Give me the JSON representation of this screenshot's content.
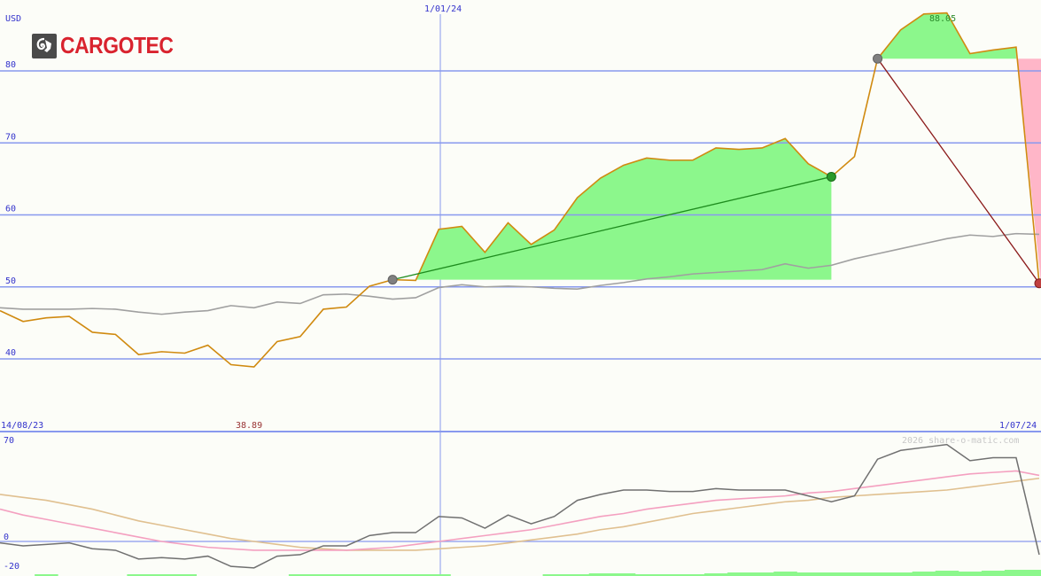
{
  "logo": {
    "name": "CARGOTEC",
    "icon": "ram-icon"
  },
  "colors": {
    "background": "#fcfdf8",
    "grid": "#8899ee",
    "price_line": "#d08a10",
    "moving_average": "#a0a0a0",
    "gain_fill": "#8cf78c",
    "loss_fill": "#ffb6c8",
    "up_trend": "#1e8c1e",
    "down_trend": "#8b1a1a",
    "osc_line": "#707070",
    "osc_pink": "#f4a0c0",
    "osc_tan": "#e0c090",
    "label_blue": "#3333cc",
    "label_red": "#993333"
  },
  "chart_data": [
    {
      "type": "line",
      "title": "",
      "ylabel": "USD",
      "ylim": [
        35,
        89
      ],
      "yticks": [
        40,
        50,
        60,
        70,
        80
      ],
      "x_start_label": "14/08/23",
      "x_mid_label": "1/01/24",
      "x_end_label": "1/07/24",
      "min_label": "38.89",
      "max_label": "88.05",
      "series": [
        {
          "key": "price",
          "values": [
            46.7,
            45.2,
            45.7,
            45.9,
            43.7,
            43.4,
            40.6,
            41.0,
            40.8,
            41.9,
            39.2,
            38.89,
            42.4,
            43.1,
            46.9,
            47.2,
            50.1,
            51.0,
            50.9,
            58.0,
            58.4,
            54.8,
            58.9,
            55.9,
            57.9,
            62.4,
            65.1,
            66.9,
            67.9,
            67.6,
            67.6,
            69.3,
            69.1,
            69.3,
            70.6,
            67.1,
            65.3,
            68.1,
            81.7,
            85.7,
            87.9,
            88.05,
            82.4,
            82.9,
            83.3,
            50.5
          ]
        },
        {
          "key": "moving_average",
          "values": [
            47.1,
            46.9,
            46.9,
            46.9,
            47.0,
            46.9,
            46.5,
            46.2,
            46.5,
            46.7,
            47.4,
            47.1,
            47.9,
            47.7,
            48.9,
            49.0,
            48.7,
            48.3,
            48.5,
            49.9,
            50.3,
            50.0,
            50.1,
            50.0,
            49.8,
            49.7,
            50.2,
            50.6,
            51.1,
            51.4,
            51.8,
            52.0,
            52.2,
            52.4,
            53.2,
            52.6,
            53.0,
            53.9,
            54.6,
            55.3,
            56.0,
            56.7,
            57.2,
            57.0,
            57.4,
            57.3
          ]
        }
      ],
      "trend_lines": [
        {
          "from_index": 17,
          "to_index": 36,
          "from_value": 51.0,
          "to_value": 65.3,
          "direction": "up"
        },
        {
          "from_index": 38,
          "to_index": 45,
          "from_value": 81.7,
          "to_value": 50.5,
          "direction": "down"
        }
      ],
      "gain_region": {
        "from_index": 17,
        "to_index": 36,
        "base": 51.0
      },
      "gain_region_2": {
        "from_index": 38,
        "to_index": 44,
        "base": 81.7
      },
      "loss_region": {
        "from_index": 44,
        "to_index": 45,
        "top": 81.7
      }
    },
    {
      "type": "line",
      "title": "",
      "ylim": [
        -22,
        75
      ],
      "yticks": [
        70,
        0,
        -20
      ],
      "watermark": "2026 share-o-matic.com",
      "series": [
        {
          "key": "oscillator",
          "values": [
            -1,
            -3,
            -2,
            -1,
            -5,
            -6,
            -12,
            -11,
            -12,
            -10,
            -17,
            -18,
            -10,
            -9,
            -3,
            -3,
            4,
            6,
            6,
            17,
            16,
            9,
            18,
            12,
            17,
            28,
            32,
            35,
            35,
            34,
            34,
            36,
            35,
            35,
            35,
            31,
            27,
            31,
            56,
            62,
            64,
            66,
            55,
            57,
            57,
            -9
          ]
        },
        {
          "key": "signal_pink",
          "values": [
            22,
            18,
            15,
            12,
            9,
            6,
            3,
            0,
            -2,
            -4,
            -5,
            -6,
            -6,
            -6,
            -6,
            -6,
            -5,
            -4,
            -2,
            0,
            2,
            4,
            6,
            8,
            11,
            14,
            17,
            19,
            22,
            24,
            26,
            28,
            29,
            30,
            31,
            33,
            34,
            36,
            38,
            40,
            42,
            44,
            46,
            47,
            48,
            45
          ]
        },
        {
          "key": "signal_tan",
          "values": [
            32,
            30,
            28,
            25,
            22,
            18,
            14,
            11,
            8,
            5,
            2,
            0,
            -2,
            -4,
            -5,
            -6,
            -6,
            -6,
            -6,
            -5,
            -4,
            -3,
            -1,
            1,
            3,
            5,
            8,
            10,
            13,
            16,
            19,
            21,
            23,
            25,
            27,
            28,
            30,
            31,
            32,
            33,
            34,
            35,
            37,
            39,
            41,
            43
          ]
        }
      ],
      "histogram": [
        0,
        0,
        2,
        0,
        0,
        0,
        2,
        2,
        2,
        0,
        0,
        0,
        0,
        2,
        2,
        2,
        2,
        2,
        2,
        2,
        0,
        0,
        0,
        0,
        2,
        2,
        3,
        3,
        2,
        2,
        2,
        3,
        4,
        4,
        5,
        4,
        4,
        4,
        4,
        4,
        5,
        6,
        5,
        6,
        7,
        7
      ]
    }
  ]
}
